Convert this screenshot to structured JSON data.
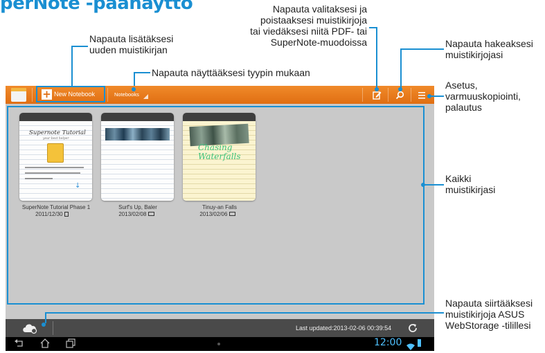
{
  "page_title": "perNote -päänäyttö",
  "callouts": {
    "new_notebook": [
      "Napauta lisätäksesi",
      "uuden muistikirjan"
    ],
    "filter_type": "Napauta näyttääksesi tyypin mukaan",
    "select": [
      "Napauta valitaksesi ja",
      "poistaaksesi muistikirjoja",
      "tai viedäksesi niitä PDF- tai",
      "SuperNote-muodoissa"
    ],
    "search": [
      "Napauta hakeaksesi",
      "muistikirjojasi"
    ],
    "settings": [
      "Asetus,",
      "varmuuskopiointi,",
      "palautus"
    ],
    "all_notebooks": [
      "Kaikki",
      "muistikirjasi"
    ],
    "webstorage": [
      "Napauta siirtääksesi",
      "muistikirjoja ASUS",
      "WebStorage -tilillesi"
    ]
  },
  "actionbar": {
    "new_notebook_label": "New Notebook",
    "notebooks_dropdown": "Notebooks"
  },
  "notebooks": [
    {
      "name": "SuperNote Tutorial Phase 1",
      "date": "2011/12/30",
      "thumb_title": "Supernote Tutorial",
      "thumb_sub": "your best helper"
    },
    {
      "name": "Surf's Up, Baler",
      "date": "2013/02/08"
    },
    {
      "name": "Tinuy-an Falls",
      "date": "2013/02/06",
      "thumb_title": "Chasing Waterfalls"
    }
  ],
  "status": {
    "last_updated": "Last updated:2013-02-06 00:39:54",
    "clock": "12:00"
  },
  "icons": {
    "accent": "#1a8fd2",
    "bar_orange": "#e8791c"
  }
}
